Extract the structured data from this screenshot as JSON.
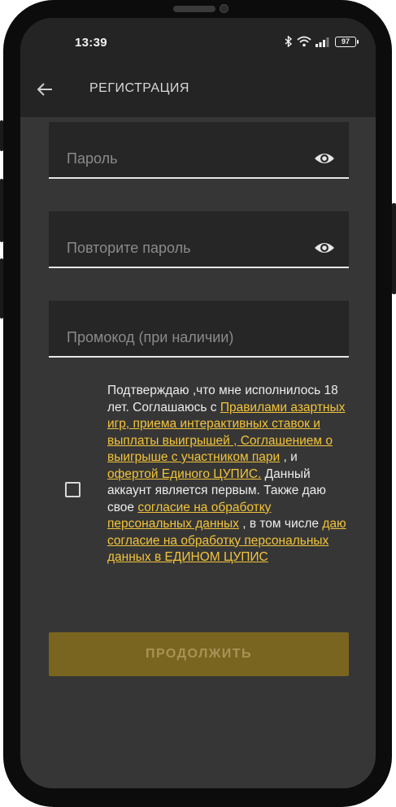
{
  "status_bar": {
    "time": "13:39",
    "signal_icons": "bluetooth-icon wifi-icon signal-icon",
    "battery": "97"
  },
  "app_bar": {
    "back_icon": "arrow-left-icon",
    "title": "РЕГИСТРАЦИЯ"
  },
  "fields": {
    "password_placeholder": "Пароль",
    "repeat_password_placeholder": "Повторите пароль",
    "promo_placeholder": "Промокод (при наличии)"
  },
  "agreement": {
    "checked": false,
    "t1": "Подтверждаю ,что мне исполнилось 18 лет. Соглашаюсь с ",
    "link1": "Правилами азартных игр, приема интерактивных ставок и выплаты выигрышей , Соглашением о выигрыше с участником пари",
    "t2": " , и ",
    "link2": "офертой Единого ЦУПИС.",
    "t3": " Данный аккаунт является первым. Также даю свое ",
    "link3": "согласие на обработку персональных данных",
    "t4": " , в том числе ",
    "link4": "даю согласие на обработку персональных данных в ЕДИНОМ ЦУПИС"
  },
  "continue_button": "ПРОДОЛЖИТЬ",
  "colors": {
    "accent": "#f2c43a",
    "button_disabled": "#7a6520",
    "screen_bg": "#363636",
    "field_bg": "#262626"
  }
}
